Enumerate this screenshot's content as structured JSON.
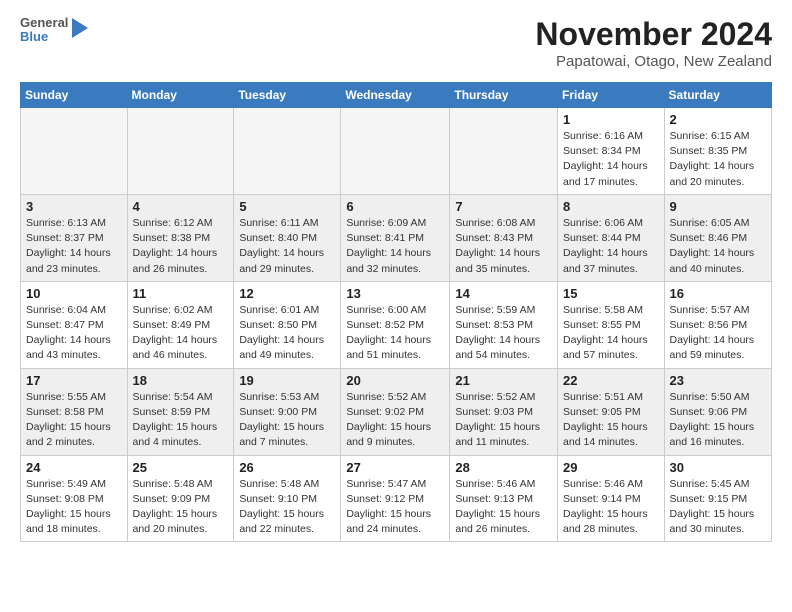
{
  "header": {
    "logo_general": "General",
    "logo_blue": "Blue",
    "month_title": "November 2024",
    "location": "Papatowai, Otago, New Zealand"
  },
  "weekdays": [
    "Sunday",
    "Monday",
    "Tuesday",
    "Wednesday",
    "Thursday",
    "Friday",
    "Saturday"
  ],
  "weeks": [
    [
      {
        "day": "",
        "info": ""
      },
      {
        "day": "",
        "info": ""
      },
      {
        "day": "",
        "info": ""
      },
      {
        "day": "",
        "info": ""
      },
      {
        "day": "",
        "info": ""
      },
      {
        "day": "1",
        "info": "Sunrise: 6:16 AM\nSunset: 8:34 PM\nDaylight: 14 hours\nand 17 minutes."
      },
      {
        "day": "2",
        "info": "Sunrise: 6:15 AM\nSunset: 8:35 PM\nDaylight: 14 hours\nand 20 minutes."
      }
    ],
    [
      {
        "day": "3",
        "info": "Sunrise: 6:13 AM\nSunset: 8:37 PM\nDaylight: 14 hours\nand 23 minutes."
      },
      {
        "day": "4",
        "info": "Sunrise: 6:12 AM\nSunset: 8:38 PM\nDaylight: 14 hours\nand 26 minutes."
      },
      {
        "day": "5",
        "info": "Sunrise: 6:11 AM\nSunset: 8:40 PM\nDaylight: 14 hours\nand 29 minutes."
      },
      {
        "day": "6",
        "info": "Sunrise: 6:09 AM\nSunset: 8:41 PM\nDaylight: 14 hours\nand 32 minutes."
      },
      {
        "day": "7",
        "info": "Sunrise: 6:08 AM\nSunset: 8:43 PM\nDaylight: 14 hours\nand 35 minutes."
      },
      {
        "day": "8",
        "info": "Sunrise: 6:06 AM\nSunset: 8:44 PM\nDaylight: 14 hours\nand 37 minutes."
      },
      {
        "day": "9",
        "info": "Sunrise: 6:05 AM\nSunset: 8:46 PM\nDaylight: 14 hours\nand 40 minutes."
      }
    ],
    [
      {
        "day": "10",
        "info": "Sunrise: 6:04 AM\nSunset: 8:47 PM\nDaylight: 14 hours\nand 43 minutes."
      },
      {
        "day": "11",
        "info": "Sunrise: 6:02 AM\nSunset: 8:49 PM\nDaylight: 14 hours\nand 46 minutes."
      },
      {
        "day": "12",
        "info": "Sunrise: 6:01 AM\nSunset: 8:50 PM\nDaylight: 14 hours\nand 49 minutes."
      },
      {
        "day": "13",
        "info": "Sunrise: 6:00 AM\nSunset: 8:52 PM\nDaylight: 14 hours\nand 51 minutes."
      },
      {
        "day": "14",
        "info": "Sunrise: 5:59 AM\nSunset: 8:53 PM\nDaylight: 14 hours\nand 54 minutes."
      },
      {
        "day": "15",
        "info": "Sunrise: 5:58 AM\nSunset: 8:55 PM\nDaylight: 14 hours\nand 57 minutes."
      },
      {
        "day": "16",
        "info": "Sunrise: 5:57 AM\nSunset: 8:56 PM\nDaylight: 14 hours\nand 59 minutes."
      }
    ],
    [
      {
        "day": "17",
        "info": "Sunrise: 5:55 AM\nSunset: 8:58 PM\nDaylight: 15 hours\nand 2 minutes."
      },
      {
        "day": "18",
        "info": "Sunrise: 5:54 AM\nSunset: 8:59 PM\nDaylight: 15 hours\nand 4 minutes."
      },
      {
        "day": "19",
        "info": "Sunrise: 5:53 AM\nSunset: 9:00 PM\nDaylight: 15 hours\nand 7 minutes."
      },
      {
        "day": "20",
        "info": "Sunrise: 5:52 AM\nSunset: 9:02 PM\nDaylight: 15 hours\nand 9 minutes."
      },
      {
        "day": "21",
        "info": "Sunrise: 5:52 AM\nSunset: 9:03 PM\nDaylight: 15 hours\nand 11 minutes."
      },
      {
        "day": "22",
        "info": "Sunrise: 5:51 AM\nSunset: 9:05 PM\nDaylight: 15 hours\nand 14 minutes."
      },
      {
        "day": "23",
        "info": "Sunrise: 5:50 AM\nSunset: 9:06 PM\nDaylight: 15 hours\nand 16 minutes."
      }
    ],
    [
      {
        "day": "24",
        "info": "Sunrise: 5:49 AM\nSunset: 9:08 PM\nDaylight: 15 hours\nand 18 minutes."
      },
      {
        "day": "25",
        "info": "Sunrise: 5:48 AM\nSunset: 9:09 PM\nDaylight: 15 hours\nand 20 minutes."
      },
      {
        "day": "26",
        "info": "Sunrise: 5:48 AM\nSunset: 9:10 PM\nDaylight: 15 hours\nand 22 minutes."
      },
      {
        "day": "27",
        "info": "Sunrise: 5:47 AM\nSunset: 9:12 PM\nDaylight: 15 hours\nand 24 minutes."
      },
      {
        "day": "28",
        "info": "Sunrise: 5:46 AM\nSunset: 9:13 PM\nDaylight: 15 hours\nand 26 minutes."
      },
      {
        "day": "29",
        "info": "Sunrise: 5:46 AM\nSunset: 9:14 PM\nDaylight: 15 hours\nand 28 minutes."
      },
      {
        "day": "30",
        "info": "Sunrise: 5:45 AM\nSunset: 9:15 PM\nDaylight: 15 hours\nand 30 minutes."
      }
    ]
  ]
}
